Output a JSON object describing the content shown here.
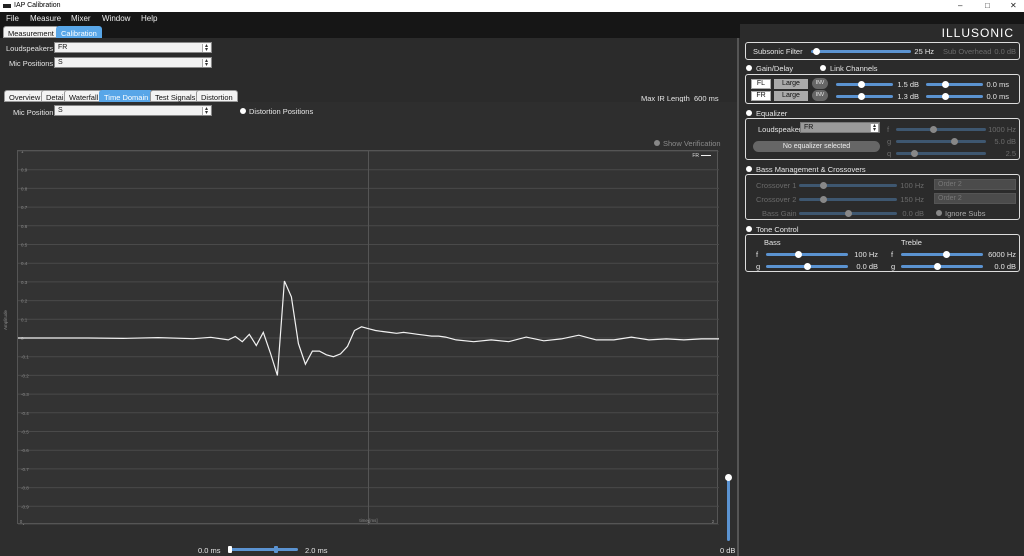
{
  "window": {
    "title": "IAP Calibration",
    "min": "–",
    "max": "□",
    "close": "✕"
  },
  "menu": [
    "File",
    "Measure",
    "Mixer",
    "Window",
    "Help"
  ],
  "top_tabs": [
    "Measurement",
    "Calibration"
  ],
  "brand": "ILLUSONIC",
  "loudspeakers": {
    "label": "Loudspeakers",
    "value": "FR"
  },
  "mic_positions": {
    "label": "Mic Positions",
    "value": "S"
  },
  "view_tabs": [
    "Overview",
    "Detail",
    "Waterfall",
    "Time Domain",
    "Test Signals",
    "Distortion"
  ],
  "max_ir": {
    "label": "Max IR Length",
    "value": "600 ms"
  },
  "mic_position": {
    "label": "Mic Position",
    "value": "S"
  },
  "distortion_positions": "Distortion Positions",
  "show_verification": "Show Verification",
  "chart_data": {
    "type": "line",
    "xlabel": "time [ms]",
    "ylabel": "Amplitude",
    "xlim": [
      0,
      2
    ],
    "ylim": [
      -1,
      1
    ],
    "x_ticks": [
      "0",
      "1",
      "2"
    ],
    "y_ticks": [
      "1",
      "0.9",
      "0.8",
      "0.7",
      "0.6",
      "0.5",
      "0.4",
      "0.3",
      "0.2",
      "0.1",
      "0",
      "-0.1",
      "-0.2",
      "-0.3",
      "-0.4",
      "-0.5",
      "-0.6",
      "-0.7",
      "-0.8",
      "-0.9",
      "-1"
    ],
    "legend": "FR",
    "grid": true,
    "series": [
      {
        "name": "FR",
        "x": [
          0,
          0.1,
          0.2,
          0.3,
          0.4,
          0.5,
          0.55,
          0.6,
          0.62,
          0.64,
          0.66,
          0.68,
          0.7,
          0.72,
          0.74,
          0.76,
          0.78,
          0.8,
          0.82,
          0.84,
          0.86,
          0.88,
          0.9,
          0.92,
          0.94,
          0.96,
          0.98,
          1.0,
          1.02,
          1.04,
          1.06,
          1.08,
          1.1,
          1.12,
          1.14,
          1.16,
          1.18,
          1.2,
          1.22,
          1.25,
          1.3,
          1.35,
          1.4,
          1.45,
          1.5,
          1.55,
          1.6,
          1.65,
          1.7,
          1.75,
          1.8,
          1.85,
          1.9,
          1.95,
          2.0
        ],
        "y": [
          0,
          0,
          0,
          -0.002,
          0.002,
          -0.004,
          0.004,
          -0.01,
          0.008,
          -0.02,
          0.02,
          -0.04,
          0.03,
          -0.08,
          -0.2,
          0.305,
          0.22,
          -0.03,
          -0.14,
          -0.07,
          -0.07,
          -0.09,
          -0.1,
          -0.085,
          -0.045,
          0.04,
          0.06,
          0.05,
          0.04,
          0.035,
          0.03,
          0.025,
          0.03,
          0.025,
          0.02,
          0.015,
          0.01,
          0.01,
          0.005,
          -0.01,
          -0.02,
          -0.01,
          -0.02,
          0.005,
          -0.015,
          -0.005,
          0.015,
          -0.01,
          -0.01,
          0.005,
          -0.01,
          -0.005,
          -0.01,
          -0.005,
          -0.005
        ]
      }
    ]
  },
  "time_range": {
    "start": "0.0 ms",
    "end": "2.0 ms",
    "level": "0 dB",
    "range_start": 0,
    "range_end": 0.68
  },
  "vertical_level": 0.98,
  "subsonic": {
    "label": "Subsonic Filter",
    "value": "25 Hz",
    "overhead_label": "Sub Overhead",
    "overhead_value": "0.0 dB",
    "level": 0.05
  },
  "gain_delay": {
    "title": "Gain/Delay",
    "link": "Link Channels",
    "rows": [
      {
        "ch": "FL",
        "size": "Large",
        "inv": "INV",
        "gain": "1.5 dB",
        "delay": "0.0 ms",
        "g": 0.45,
        "d": 0.35
      },
      {
        "ch": "FR",
        "size": "Large",
        "inv": "INV",
        "gain": "1.3 dB",
        "delay": "0.0 ms",
        "g": 0.45,
        "d": 0.35
      }
    ]
  },
  "equalizer": {
    "title": "Equalizer",
    "ls_label": "Loudspeaker",
    "ls_value": "FR",
    "no_eq": "No equalizer selected",
    "f": "f",
    "g": "g",
    "q": "q",
    "f_val": "1000 Hz",
    "g_val": "5.0 dB",
    "q_val": "2.5",
    "f_pos": 0.42,
    "g_pos": 0.65,
    "q_pos": 0.2
  },
  "bass_mgmt": {
    "title": "Bass Management & Crossovers",
    "c1": "Crossover 1",
    "c1_val": "100 Hz",
    "c2": "Crossover 2",
    "c2_val": "150 Hz",
    "bg": "Bass Gain",
    "bg_val": "0.0 dB",
    "o1": "Order 2",
    "o2": "Order 2",
    "ignore": "Ignore Subs",
    "c1_pos": 0.25,
    "c2_pos": 0.25,
    "bg_pos": 0.5
  },
  "tone": {
    "title": "Tone Control",
    "bass": "Bass",
    "treble": "Treble",
    "f": "f",
    "g": "g",
    "bass_f": "100 Hz",
    "bass_g": "0.0 dB",
    "treble_f": "6000 Hz",
    "treble_g": "0.0 dB",
    "bf_pos": 0.4,
    "bg_pos": 0.5,
    "tf_pos": 0.55,
    "tg_pos": 0.45
  }
}
